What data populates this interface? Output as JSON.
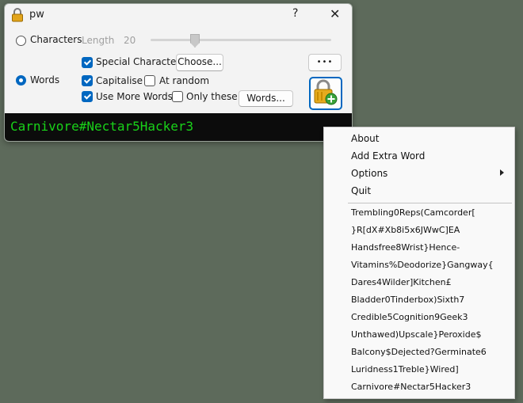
{
  "window": {
    "title": "pw",
    "help_label": "?",
    "close_label": "✕"
  },
  "mode": {
    "characters_label": "Characters",
    "length_label": "Length",
    "length_value": "20",
    "words_label": "Words",
    "selected": "Words"
  },
  "options": {
    "special_characters": {
      "label": "Special Characters",
      "checked": true
    },
    "choose_button": "Choose...",
    "capitalise": {
      "label": "Capitalise",
      "checked": true
    },
    "at_random": {
      "label": "At random",
      "checked": false
    },
    "use_more_words": {
      "label": "Use More Words",
      "checked": true
    },
    "only_these": {
      "label": "Only these",
      "checked": false
    },
    "words_button": "Words...",
    "more_button": "•••"
  },
  "output": {
    "password": "Carnivore#Nectar5Hacker3",
    "color": "#19d219"
  },
  "context_menu": {
    "items": [
      "About",
      "Add Extra Word",
      "Options",
      "Quit"
    ],
    "history": [
      "Trembling0Reps(Camcorder[",
      "}R[dX#Xb8i5x6JWwC]EA",
      "Handsfree8Wrist}Hence-",
      "Vitamins%Deodorize}Gangway{",
      "Dares4Wilder]Kitchen£",
      "Bladder0Tinderbox)Sixth7",
      "Credible5Cognition9Geek3",
      "Unthawed)Upscale}Peroxide$",
      "Balcony$Dejected?Germinate6",
      "Luridness1Treble}Wired]",
      "Carnivore#Nectar5Hacker3"
    ]
  },
  "colors": {
    "accent": "#0067c0",
    "desktop": "#5d6a5b"
  }
}
